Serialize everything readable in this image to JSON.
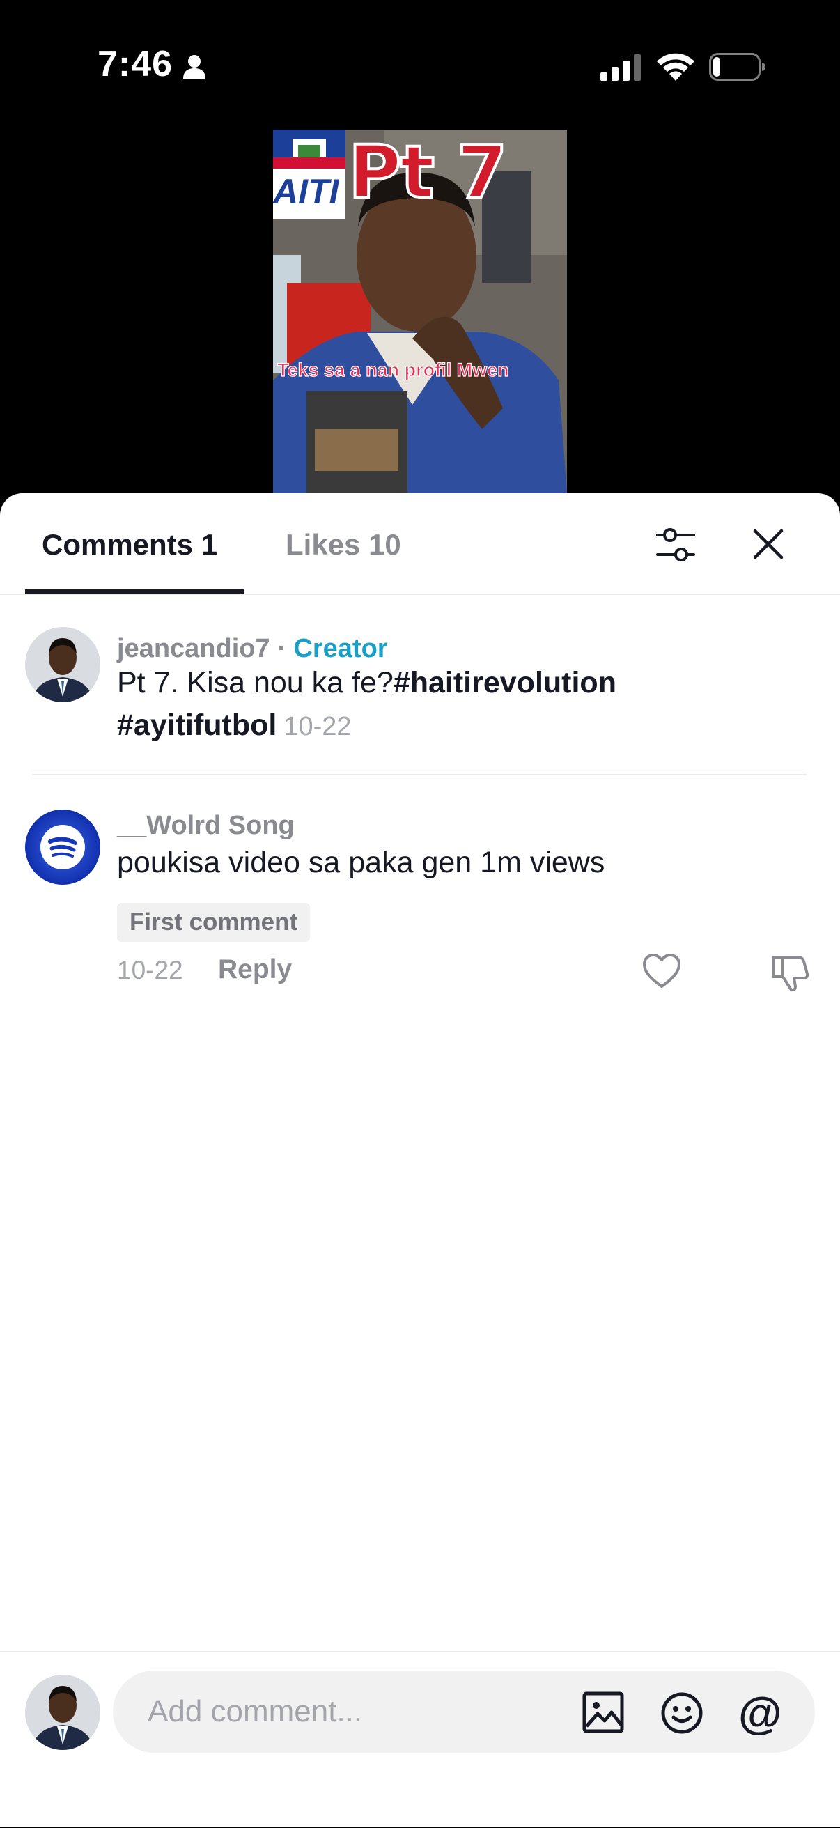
{
  "status_bar": {
    "time": "7:46",
    "icons": [
      "person-icon",
      "cellular-signal-icon",
      "wifi-icon",
      "battery-icon"
    ]
  },
  "video": {
    "overlay_title": "Pt 7",
    "flag_sticker_text": "AITI",
    "caption": "Teks sa a nan profil Mwen"
  },
  "tabs": {
    "comments_label": "Comments 1",
    "likes_label": "Likes 10"
  },
  "comments": [
    {
      "username": "jeancandio7",
      "separator": " · ",
      "badge": "Creator",
      "text_plain": "Pt 7. Kisa nou ka fe?",
      "hashtag_1": "#haitirevolution",
      "hashtag_2": "#ayitifutbol",
      "date": "10-22"
    },
    {
      "username": "__Wolrd Song",
      "text": "poukisa video sa paka gen 1m views",
      "badge": "First comment",
      "date": "10-22",
      "reply_label": "Reply"
    }
  ],
  "composer": {
    "placeholder": "Add comment...",
    "mention_symbol": "@"
  },
  "colors": {
    "accent_creator": "#1aa0c8",
    "text_primary": "#161823",
    "text_secondary": "#8a8b91",
    "sheet_bg": "#ffffff",
    "input_bg": "#f1f1f2"
  }
}
